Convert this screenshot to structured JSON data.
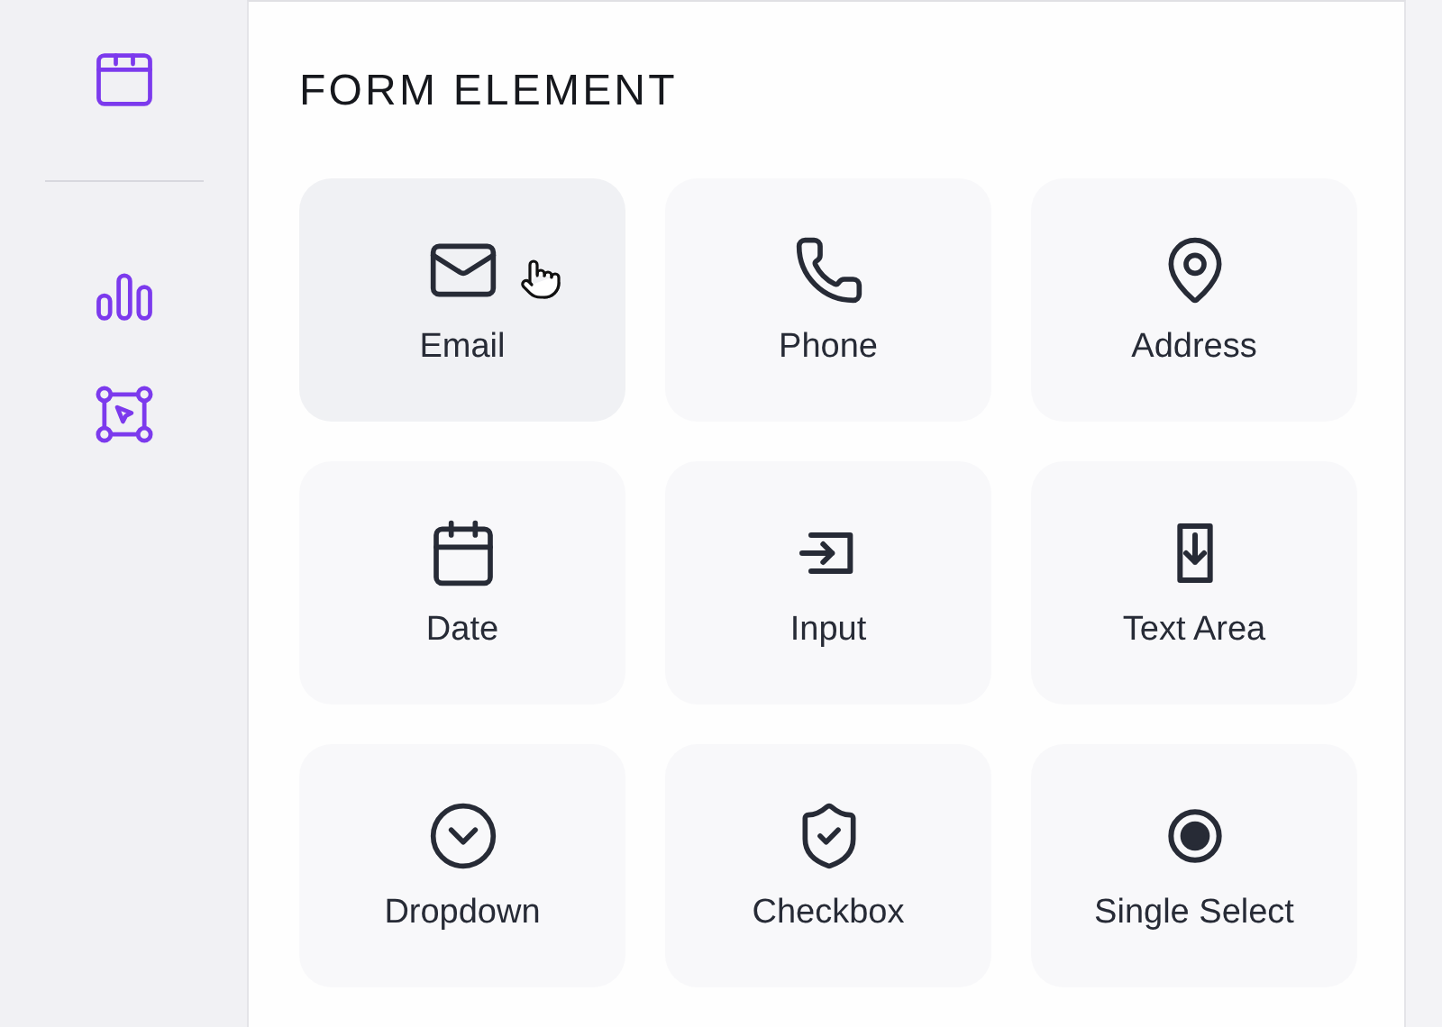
{
  "sidebar": {
    "top_items": [
      {
        "kind": "calendar"
      }
    ],
    "items": [
      {
        "kind": "chart"
      },
      {
        "kind": "select"
      }
    ]
  },
  "panel": {
    "title": "FORM ELEMENT",
    "elements": [
      {
        "label": "Email",
        "kind": "email",
        "hovered": true
      },
      {
        "label": "Phone",
        "kind": "phone",
        "hovered": false
      },
      {
        "label": "Address",
        "kind": "address",
        "hovered": false
      },
      {
        "label": "Date",
        "kind": "date",
        "hovered": false
      },
      {
        "label": "Input",
        "kind": "input",
        "hovered": false
      },
      {
        "label": "Text Area",
        "kind": "textarea",
        "hovered": false
      },
      {
        "label": "Dropdown",
        "kind": "dropdown",
        "hovered": false
      },
      {
        "label": "Checkbox",
        "kind": "checkbox",
        "hovered": false
      },
      {
        "label": "Single Select",
        "kind": "radio",
        "hovered": false
      }
    ]
  }
}
